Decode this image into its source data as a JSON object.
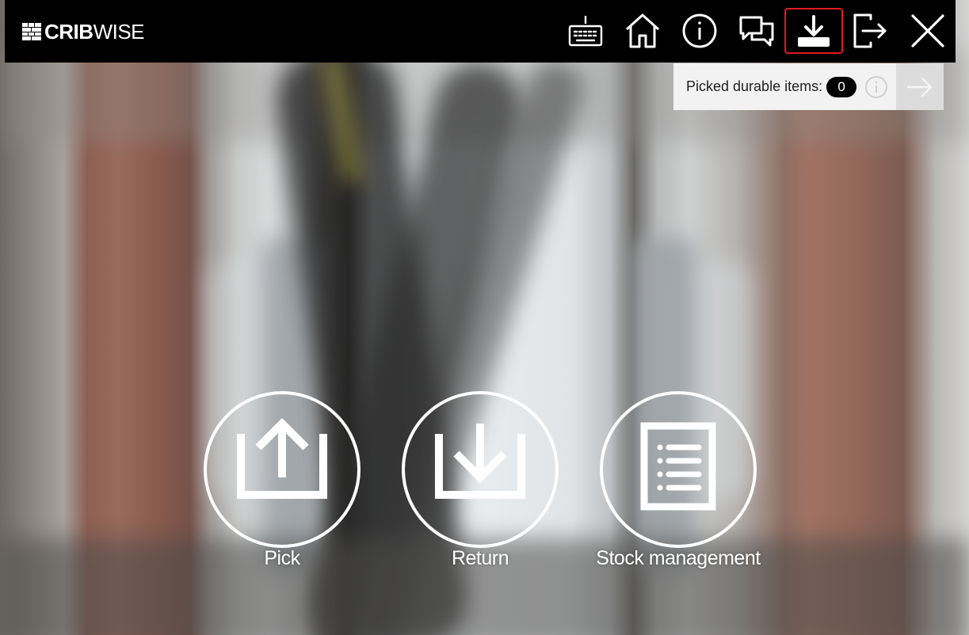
{
  "app": {
    "logo_bold": "CRIB",
    "logo_light": "WISE"
  },
  "toolbar": {
    "buttons": [
      {
        "icon": "keyboard-icon",
        "active": false
      },
      {
        "icon": "home-icon",
        "active": false
      },
      {
        "icon": "info-icon",
        "active": false
      },
      {
        "icon": "chat-icon",
        "active": false
      },
      {
        "icon": "download-icon",
        "active": true
      },
      {
        "icon": "logout-icon",
        "active": false
      },
      {
        "icon": "close-icon",
        "active": false
      }
    ],
    "active_border_color": "#e0191f"
  },
  "picked_panel": {
    "label": "Picked durable items:",
    "count": "0",
    "info_icon": "info-icon",
    "next_icon": "arrow-right-icon"
  },
  "actions": [
    {
      "label": "Pick",
      "icon": "upload-tray-icon"
    },
    {
      "label": "Return",
      "icon": "download-tray-icon"
    },
    {
      "label": "Stock management",
      "icon": "list-document-icon"
    }
  ],
  "colors": {
    "topbar": "#000000",
    "accent_active": "#e0191f",
    "action_stroke": "#ffffff"
  }
}
